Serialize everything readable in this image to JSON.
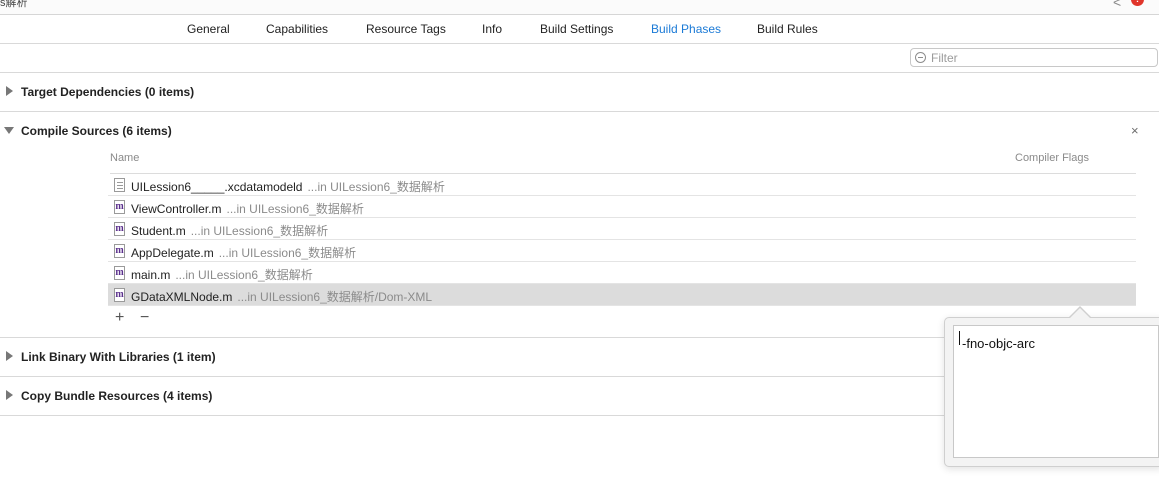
{
  "top": {
    "crumb": "s解析",
    "back_glyph": "<",
    "badge": "!"
  },
  "tabs": [
    {
      "label": "General",
      "active": false
    },
    {
      "label": "Capabilities",
      "active": false
    },
    {
      "label": "Resource Tags",
      "active": false
    },
    {
      "label": "Info",
      "active": false
    },
    {
      "label": "Build Settings",
      "active": false
    },
    {
      "label": "Build Phases",
      "active": true
    },
    {
      "label": "Build Rules",
      "active": false
    }
  ],
  "filter": {
    "placeholder": "Filter",
    "value": ""
  },
  "phases": {
    "target_dependencies": "Target Dependencies (0 items)",
    "compile_sources": "Compile Sources (6 items)",
    "link_binary": "Link Binary With Libraries (1 item)",
    "copy_bundle": "Copy Bundle Resources (4 items)"
  },
  "compile_sources": {
    "close_glyph": "×",
    "col_name": "Name",
    "col_flags": "Compiler Flags",
    "files": [
      {
        "name": "UILession6_____.xcdatamodeld",
        "path": "...in UILession6_数据解析",
        "icon": "m",
        "kind": "model",
        "selected": false
      },
      {
        "name": "ViewController.m",
        "path": "...in UILession6_数据解析",
        "icon": "m",
        "kind": "source",
        "selected": false
      },
      {
        "name": "Student.m",
        "path": "...in UILession6_数据解析",
        "icon": "m",
        "kind": "source",
        "selected": false
      },
      {
        "name": "AppDelegate.m",
        "path": "...in UILession6_数据解析",
        "icon": "m",
        "kind": "source",
        "selected": false
      },
      {
        "name": "main.m",
        "path": "...in UILession6_数据解析",
        "icon": "m",
        "kind": "source",
        "selected": false
      },
      {
        "name": "GDataXMLNode.m",
        "path": "...in UILession6_数据解析/Dom-XML",
        "icon": "m",
        "kind": "source",
        "selected": true
      }
    ],
    "add_glyph": "+",
    "remove_glyph": "−"
  },
  "flags_popover": {
    "value": "-fno-objc-arc"
  }
}
